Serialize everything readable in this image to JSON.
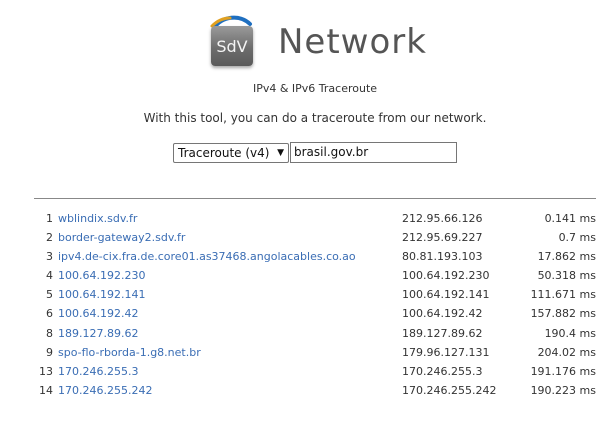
{
  "header": {
    "logo_text": "SdV",
    "title": "Network"
  },
  "subtitle": "IPv4 & IPv6 Traceroute",
  "intro": "With this tool, you can do a traceroute from our network.",
  "form": {
    "select_value": "Traceroute (v4)",
    "input_value": "brasil.gov.br"
  },
  "rows": [
    {
      "hop": "1",
      "host": "wblindix.sdv.fr",
      "ip": "212.95.66.126",
      "rtt": "0.141 ms"
    },
    {
      "hop": "2",
      "host": "border-gateway2.sdv.fr",
      "ip": "212.95.69.227",
      "rtt": "0.7 ms"
    },
    {
      "hop": "3",
      "host": "ipv4.de-cix.fra.de.core01.as37468.angolacables.co.ao",
      "ip": "80.81.193.103",
      "rtt": "17.862 ms"
    },
    {
      "hop": "4",
      "host": "100.64.192.230",
      "ip": "100.64.192.230",
      "rtt": "50.318 ms"
    },
    {
      "hop": "5",
      "host": "100.64.192.141",
      "ip": "100.64.192.141",
      "rtt": "111.671 ms"
    },
    {
      "hop": "6",
      "host": "100.64.192.42",
      "ip": "100.64.192.42",
      "rtt": "157.882 ms"
    },
    {
      "hop": "8",
      "host": "189.127.89.62",
      "ip": "189.127.89.62",
      "rtt": "190.4 ms"
    },
    {
      "hop": "9",
      "host": "spo-flo-rborda-1.g8.net.br",
      "ip": "179.96.127.131",
      "rtt": "204.02 ms"
    },
    {
      "hop": "13",
      "host": "170.246.255.3",
      "ip": "170.246.255.3",
      "rtt": "191.176 ms"
    },
    {
      "hop": "14",
      "host": "170.246.255.242",
      "ip": "170.246.255.242",
      "rtt": "190.223 ms"
    }
  ],
  "colors": {
    "link": "#3a6db4",
    "title": "#555555",
    "logo_arc": "#1f6fc0"
  }
}
